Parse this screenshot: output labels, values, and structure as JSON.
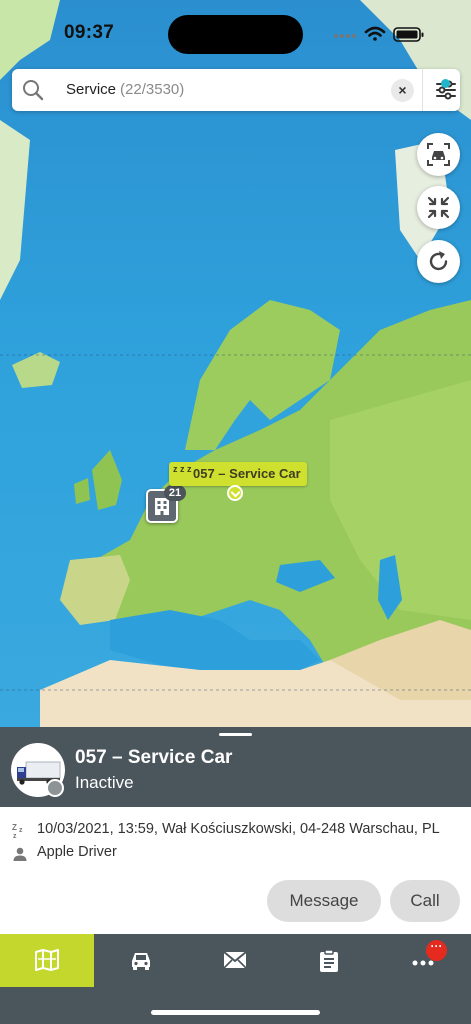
{
  "status_bar": {
    "time": "09:37"
  },
  "search": {
    "query": "Service",
    "count": "(22/3530)",
    "clear_symbol": "×"
  },
  "markers": {
    "cluster_count": "21",
    "vehicle_label": "057 – Service Car",
    "sleep_symbol": "z z z"
  },
  "sheet": {
    "vehicle_title": "057 – Service Car",
    "vehicle_status": "Inactive",
    "location_line": "10/03/2021, 13:59, Wał Kościuszkowski, 04-248 Warschau, PL",
    "driver_line": "Apple Driver",
    "message_button": "Message",
    "call_button": "Call"
  },
  "tab_bar": {
    "tabs": [
      "map-icon",
      "car-icon",
      "mail-icon",
      "clipboard-icon",
      "more-icon"
    ],
    "active_tab": "map",
    "badge_text": "···"
  },
  "colors": {
    "accent": "#c4d72c",
    "header_bg": "#4b555c",
    "badge": "#e52b1f",
    "filter_dot": "#1fb6c9"
  }
}
